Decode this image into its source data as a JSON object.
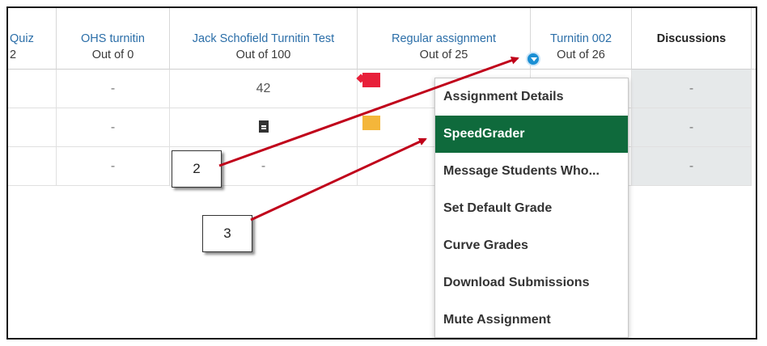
{
  "columns": [
    {
      "title": "Quiz",
      "subtitle": "2"
    },
    {
      "title": "OHS turnitin",
      "subtitle": "Out of 0"
    },
    {
      "title": "Jack Schofield Turnitin Test",
      "subtitle": "Out of 100"
    },
    {
      "title": "Regular assignment",
      "subtitle": "Out of 25"
    },
    {
      "title": "Turnitin 002",
      "subtitle": "Out of 26"
    },
    {
      "title": "Discussions",
      "subtitle": ""
    }
  ],
  "rows": [
    {
      "ohs": "-",
      "jack": "42",
      "discussions": "-"
    },
    {
      "ohs": "-",
      "jack": "",
      "discussions": "-"
    },
    {
      "ohs": "-",
      "jack": "-",
      "discussions": "-"
    }
  ],
  "menu": {
    "items": [
      {
        "label": "Assignment Details"
      },
      {
        "label": "SpeedGrader"
      },
      {
        "label": "Message Students Who..."
      },
      {
        "label": "Set Default Grade"
      },
      {
        "label": "Curve Grades"
      },
      {
        "label": "Download Submissions"
      },
      {
        "label": "Mute Assignment"
      }
    ],
    "active_color": "#0f6a3c"
  },
  "callouts": [
    {
      "label": "2"
    },
    {
      "label": "3"
    }
  ],
  "colors": {
    "link": "#2b6ea8",
    "arrow": "#c0001a",
    "menu_button": "#1a8fd4",
    "flag_red": "#e8203a",
    "flag_orange": "#f4b63a",
    "grey_cell": "#e6e9ea"
  },
  "icons": {
    "submission": "document-icon",
    "column_menu": "chevron-down-icon"
  }
}
